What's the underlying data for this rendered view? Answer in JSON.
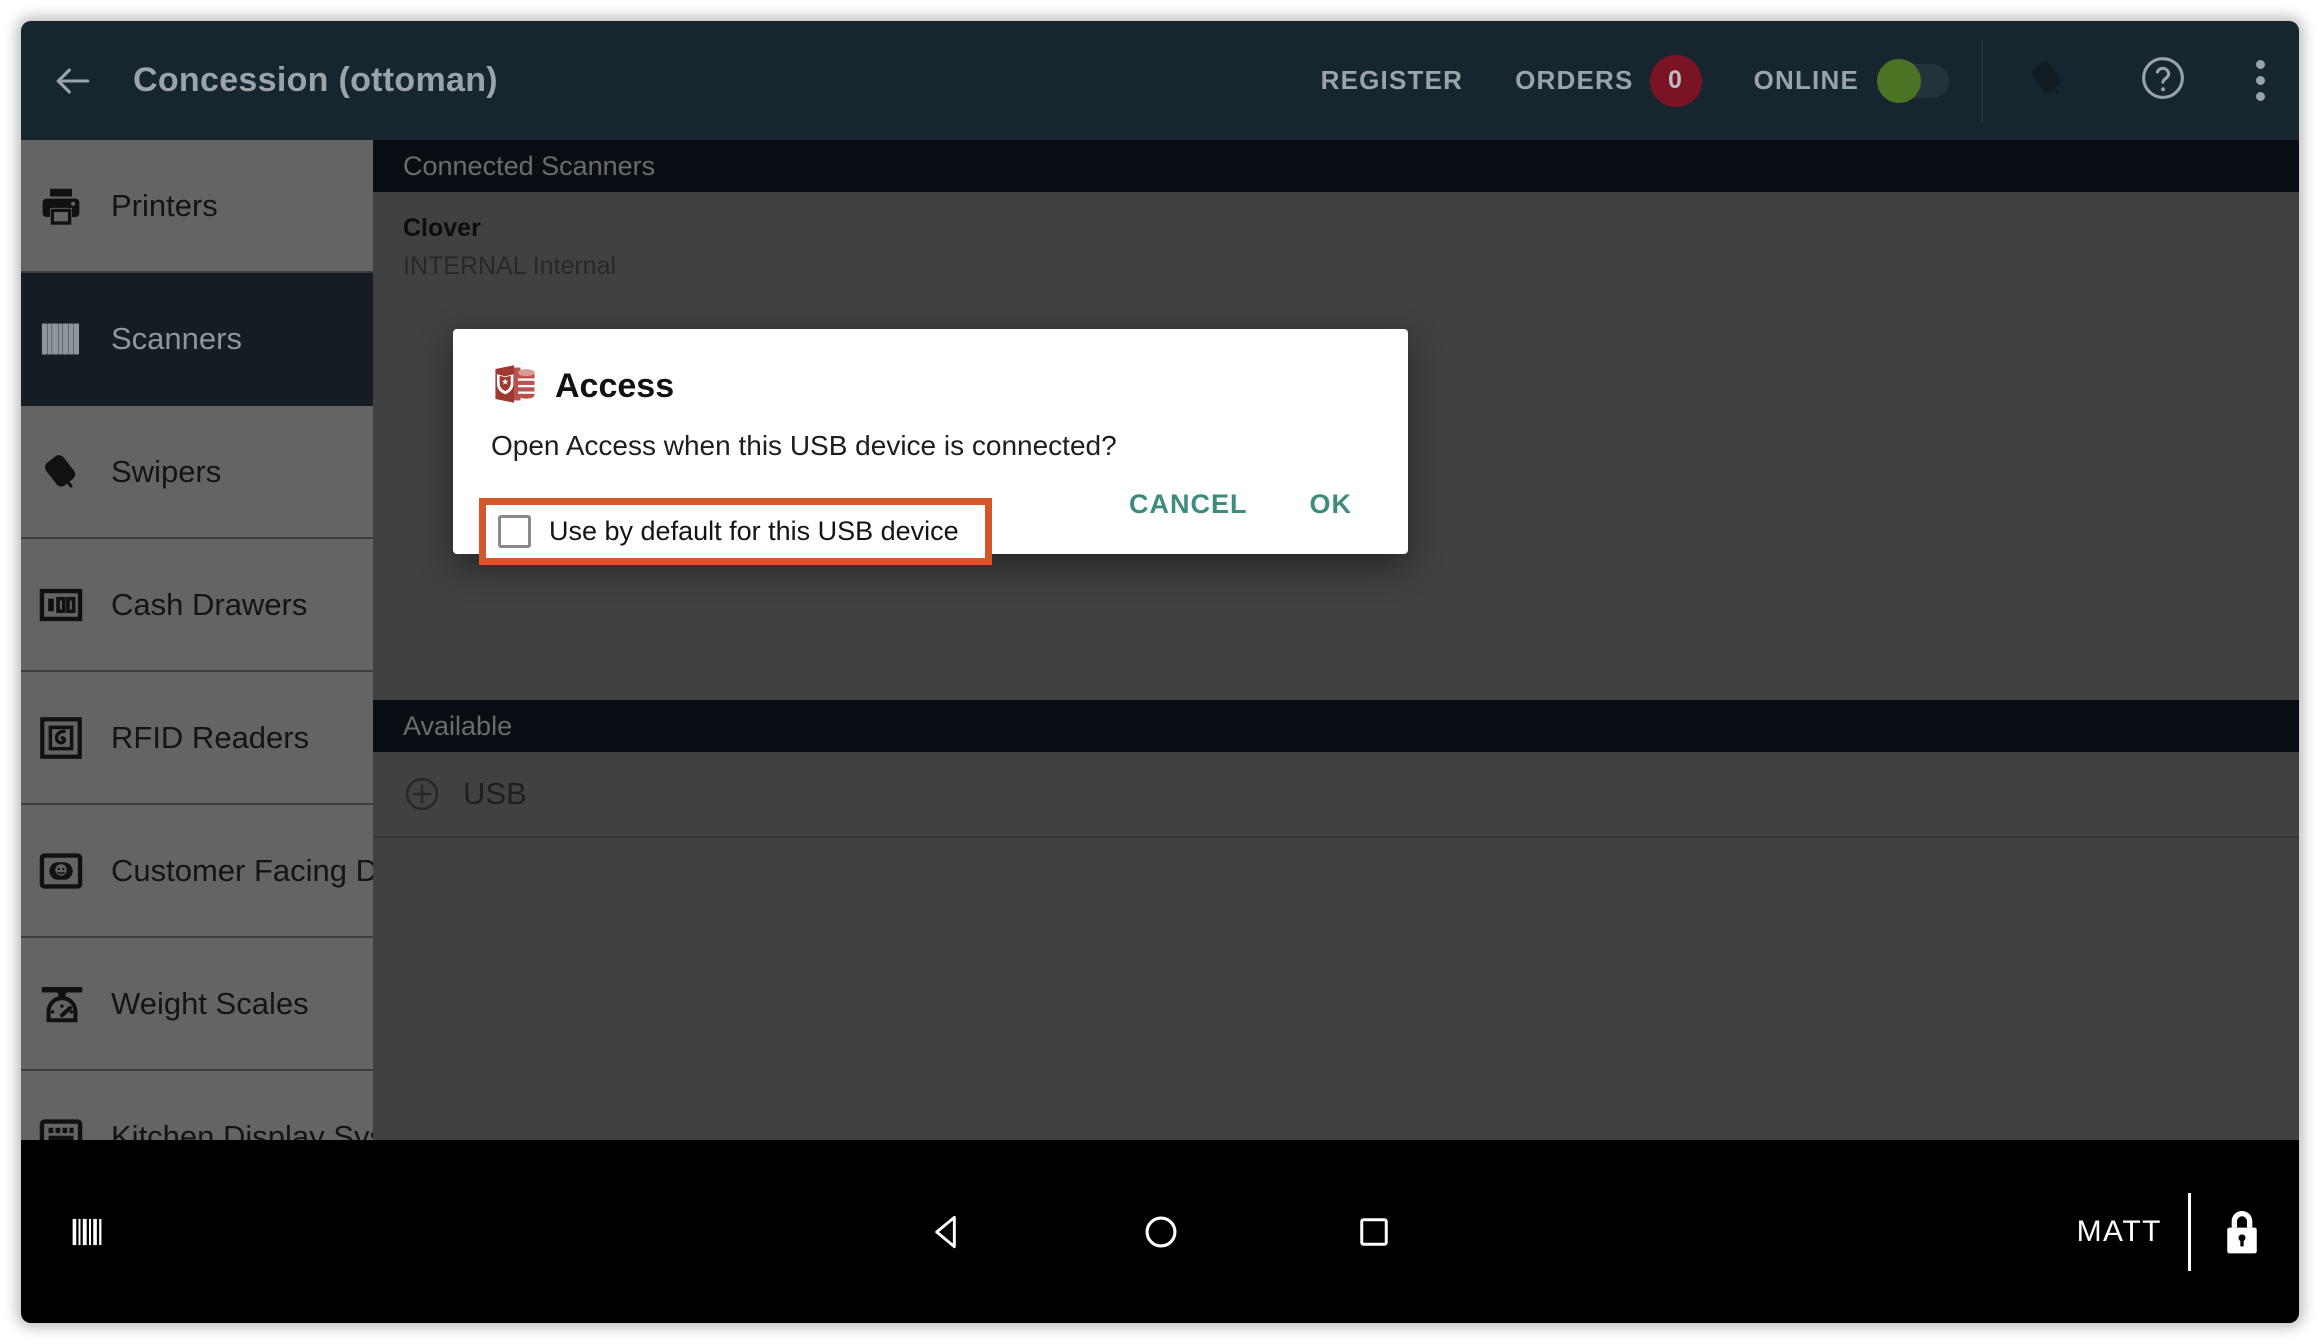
{
  "appbar": {
    "back_icon": "arrow-left-icon",
    "title": "Concession (ottoman)",
    "register_label": "REGISTER",
    "orders_label": "ORDERS",
    "orders_count": "0",
    "online_label": "ONLINE",
    "online_state": "on",
    "swiper_icon": "swiper-icon",
    "help_icon": "help-circle-icon",
    "overflow_icon": "overflow-menu-icon",
    "bg_color": "#17252f",
    "text_color": "#9aa3a9",
    "badge_color": "#7a1424",
    "toggle_on_color": "#4a7424"
  },
  "sidebar": {
    "items": [
      {
        "label": "Printers",
        "icon": "printer-icon",
        "selected": false
      },
      {
        "label": "Scanners",
        "icon": "barcode-scanner-icon",
        "selected": true
      },
      {
        "label": "Swipers",
        "icon": "swiper-icon",
        "selected": false
      },
      {
        "label": "Cash Drawers",
        "icon": "cash-drawer-icon",
        "selected": false
      },
      {
        "label": "RFID Readers",
        "icon": "rfid-reader-icon",
        "selected": false
      },
      {
        "label": "Customer Facing Displays",
        "icon": "customer-display-icon",
        "selected": false
      },
      {
        "label": "Weight Scales",
        "icon": "weight-scale-icon",
        "selected": false
      },
      {
        "label": "Kitchen Display Systems",
        "icon": "kitchen-display-icon",
        "selected": false
      }
    ],
    "selected_bg": "#151c24",
    "bg_color": "#646464"
  },
  "content": {
    "connected_header": "Connected Scanners",
    "connected_devices": [
      {
        "name": "Clover",
        "detail": "INTERNAL Internal"
      }
    ],
    "available_header": "Available",
    "available_devices": [
      {
        "label": "USB",
        "icon": "plus-circle-icon"
      }
    ],
    "header_bg": "#0e1620"
  },
  "dialog": {
    "app_icon": "access-app-icon",
    "title": "Access",
    "message": "Open Access when this USB device is connected?",
    "checkbox_label": "Use by default for this USB device",
    "checkbox_checked": false,
    "highlight_color": "#d4572a",
    "cancel_label": "CANCEL",
    "ok_label": "OK",
    "button_color": "#3d8b7d"
  },
  "system_bar": {
    "barcode_icon": "barcode-icon",
    "back_icon": "nav-back-icon",
    "home_icon": "nav-home-icon",
    "recents_icon": "nav-recents-icon",
    "user": "MATT",
    "lock_icon": "lock-icon"
  }
}
